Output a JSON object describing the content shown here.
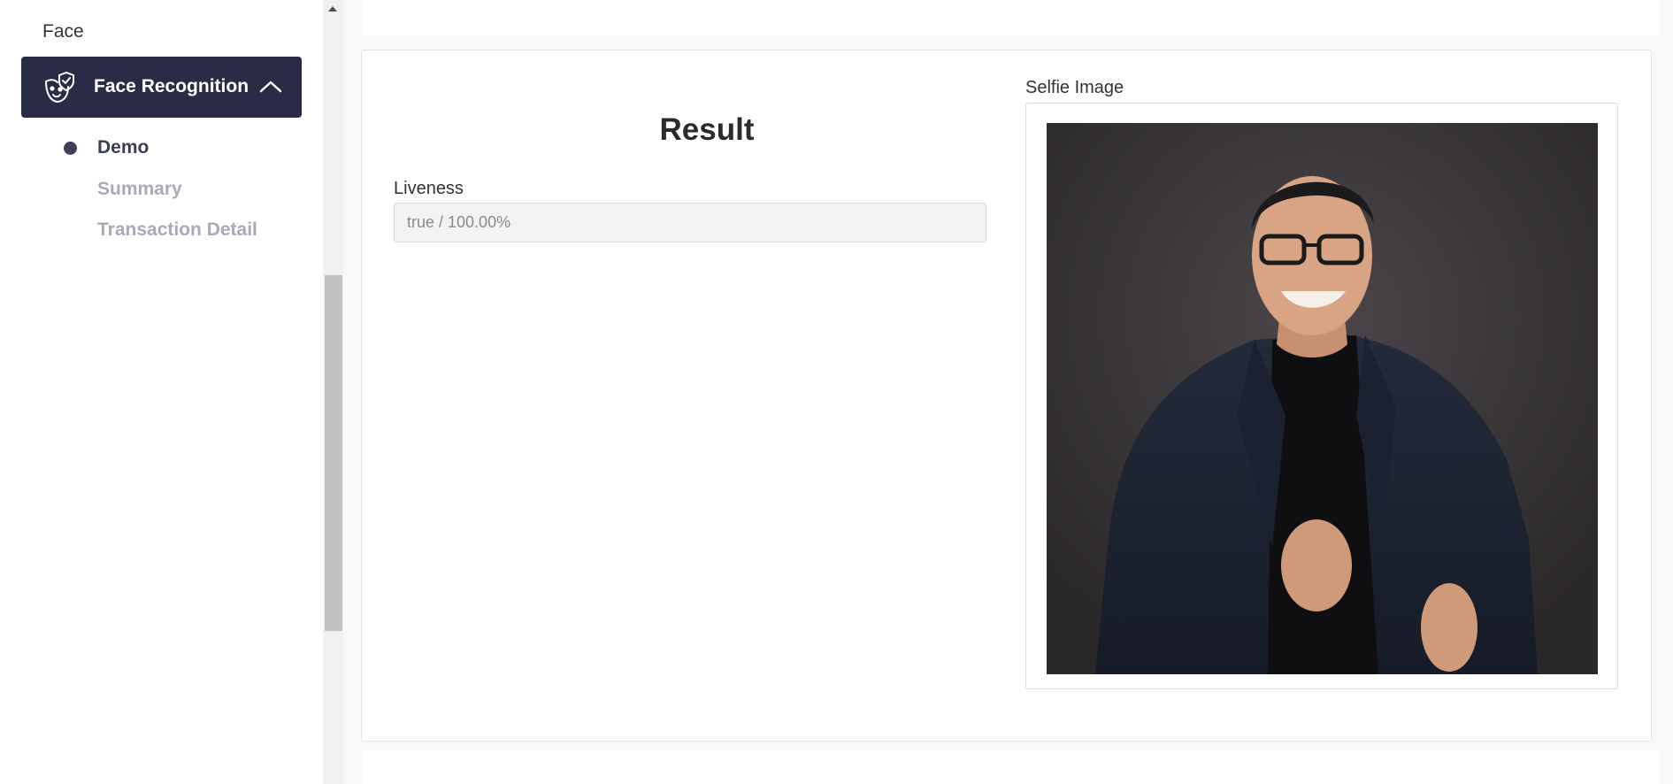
{
  "sidebar": {
    "section_label": "Face",
    "active_item": {
      "label": "Face Recognition",
      "icon": "face-mask-shield-icon",
      "expanded_indicator": "chevron-up-icon"
    },
    "subitems": [
      {
        "label": "Demo",
        "active": true
      },
      {
        "label": "Summary",
        "active": false
      },
      {
        "label": "Transaction Detail",
        "active": false
      }
    ]
  },
  "result": {
    "title": "Result",
    "liveness_label": "Liveness",
    "liveness_value": "true / 100.00%"
  },
  "selfie": {
    "label": "Selfie Image"
  },
  "colors": {
    "nav_active_bg": "#2a2c45",
    "subitem_active": "#3b3d52",
    "subitem_inactive": "#a6abb6",
    "page_bg": "#f7f8fa"
  }
}
